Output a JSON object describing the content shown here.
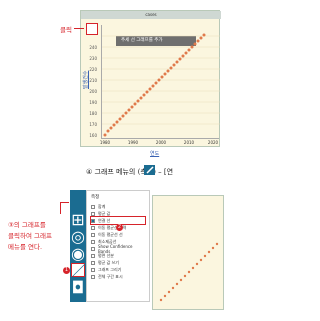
{
  "top": {
    "click_label": "클릭",
    "tooltip": "추세 선 그래프를 추가",
    "chart_title": "cases",
    "y_axis_label": "발생건수",
    "x_axis_label": "연도",
    "xticks": [
      "1980",
      "1990",
      "2000",
      "2010",
      "2020"
    ],
    "yticks": [
      "150",
      "160",
      "170",
      "180",
      "190",
      "200",
      "210",
      "220",
      "230",
      "240",
      "250"
    ]
  },
  "step_caption": "④ 그래프 메뉴의   (측정) – [연",
  "bottom": {
    "annotation": "③의 그래프를\n클릭하여 그래프\n메뉴를 연다.",
    "panel_title": "측정",
    "items": [
      {
        "label": "합계",
        "checked": false
      },
      {
        "label": "평균 값",
        "checked": false
      },
      {
        "label": "연결 선",
        "checked": true
      },
      {
        "label": "이동 평균선 입력",
        "checked": false
      },
      {
        "label": "이동 평균선 선",
        "checked": false
      },
      {
        "label": "최소제곱선",
        "checked": false
      },
      {
        "label": "Show Confidence Bands",
        "checked": false
      },
      {
        "label": "평면 선분",
        "checked": false
      },
      {
        "label": "평균 값 쓰기",
        "checked": false
      },
      {
        "label": "그래프 그리기",
        "checked": false
      },
      {
        "label": "전체 구간 표시",
        "checked": false
      }
    ],
    "marker_1": "1",
    "marker_2": "2"
  },
  "colors": {
    "accent": "#d6232a",
    "menu": "#1b6c91",
    "chart_bg": "#fbf6df",
    "points": "#e07a4b"
  }
}
